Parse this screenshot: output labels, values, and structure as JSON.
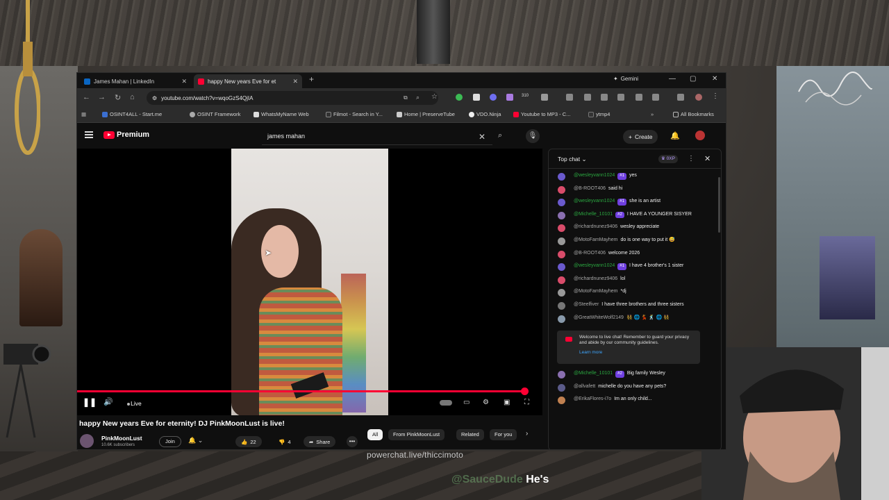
{
  "browser": {
    "tabs": [
      {
        "label": "James Mahan | LinkedIn",
        "favicon_color": "#0a66c2"
      },
      {
        "label": "happy New years Eve for et",
        "favicon_color": "#ff0033"
      }
    ],
    "gemini_label": "Gemini",
    "url": "youtube.com/watch?v=wqoGzS4QjIA",
    "extension_badge": "310",
    "bookmarks": [
      "OSINT4ALL - Start.me",
      "OSINT Framework",
      "WhatsMyName Web",
      "Filmot - Search in Y...",
      "Home | PreserveTube",
      "VDO.Ninja",
      "Youtube to MP3 - C...",
      "ytmp4"
    ],
    "all_bookmarks": "All Bookmarks"
  },
  "youtube": {
    "logo_text": "Premium",
    "search_query": "james mahan",
    "create_label": "Create",
    "video": {
      "title": "happy New years Eve for eternity! DJ PinkMoonLust is live!",
      "live_label": "Live",
      "progress": 0.99
    },
    "channel": {
      "name": "PinkMoonLust",
      "subscribers": "10.6K subscribers",
      "join_label": "Join"
    },
    "actions": {
      "likes": "22",
      "dislikes": "4",
      "share_label": "Share"
    },
    "chips": [
      "All",
      "From PinkMoonLust",
      "Related",
      "For you"
    ]
  },
  "chat": {
    "title": "Top chat",
    "xp_badge": "0XP",
    "messages": [
      {
        "author": "@wesleyvann1024",
        "badge": "#1",
        "member": true,
        "text": "yes",
        "avatar_color": "#6a5acd"
      },
      {
        "author": "@B-ROOT406",
        "badge": "",
        "member": false,
        "text": "said hi",
        "avatar_color": "#d94c6a"
      },
      {
        "author": "@wesleyvann1024",
        "badge": "#1",
        "member": true,
        "text": "she is an artist",
        "avatar_color": "#6a5acd"
      },
      {
        "author": "@Michelle_10101",
        "badge": "#2",
        "member": true,
        "text": "I HAVE A YOUNGER SISYER",
        "avatar_color": "#8a6fb0"
      },
      {
        "author": "@richardnunez9406",
        "badge": "",
        "member": false,
        "text": "wesley appreciate",
        "avatar_color": "#d94c6a"
      },
      {
        "author": "@MotoFamMayhem",
        "badge": "",
        "member": false,
        "text": "do is one way to put it 😅",
        "avatar_color": "#999999"
      },
      {
        "author": "@B-ROOT406",
        "badge": "",
        "member": false,
        "text": "welcome 2026",
        "avatar_color": "#d94c6a"
      },
      {
        "author": "@wesleyvann1024",
        "badge": "#1",
        "member": true,
        "text": "I have 4 brother's 1 sister",
        "avatar_color": "#6a5acd"
      },
      {
        "author": "@richardnunez9406",
        "badge": "",
        "member": false,
        "text": "lol",
        "avatar_color": "#d94c6a"
      },
      {
        "author": "@MotoFamMayhem",
        "badge": "",
        "member": false,
        "text": "*dj",
        "avatar_color": "#999999"
      },
      {
        "author": "@Steelfiver",
        "badge": "",
        "member": false,
        "text": "I have three brothers and three sisters",
        "avatar_color": "#777777"
      },
      {
        "author": "@GreatWhiteWolf2149",
        "badge": "",
        "member": false,
        "text": "👯 🌐 💃 🕺 🌐 👯",
        "avatar_color": "#8899aa"
      }
    ],
    "welcome": {
      "text": "Welcome to live chat! Remember to guard your privacy and abide by our community guidelines.",
      "link": "Learn more"
    },
    "messages_after": [
      {
        "author": "@Michelle_10101",
        "badge": "#2",
        "member": true,
        "text": "Big family Wesley",
        "avatar_color": "#8a6fb0"
      },
      {
        "author": "@allvafett",
        "badge": "",
        "member": false,
        "text": "michelle do you have any pets?",
        "avatar_color": "#5b5b8a"
      },
      {
        "author": "@ErikaFlores-i7o",
        "badge": "",
        "member": false,
        "text": "Im an only child...",
        "avatar_color": "#c08050"
      }
    ]
  },
  "overlay": {
    "powerchat": "powerchat.live/thiccimoto",
    "ticker_user": "@SauceDude",
    "ticker_text": "He's"
  }
}
